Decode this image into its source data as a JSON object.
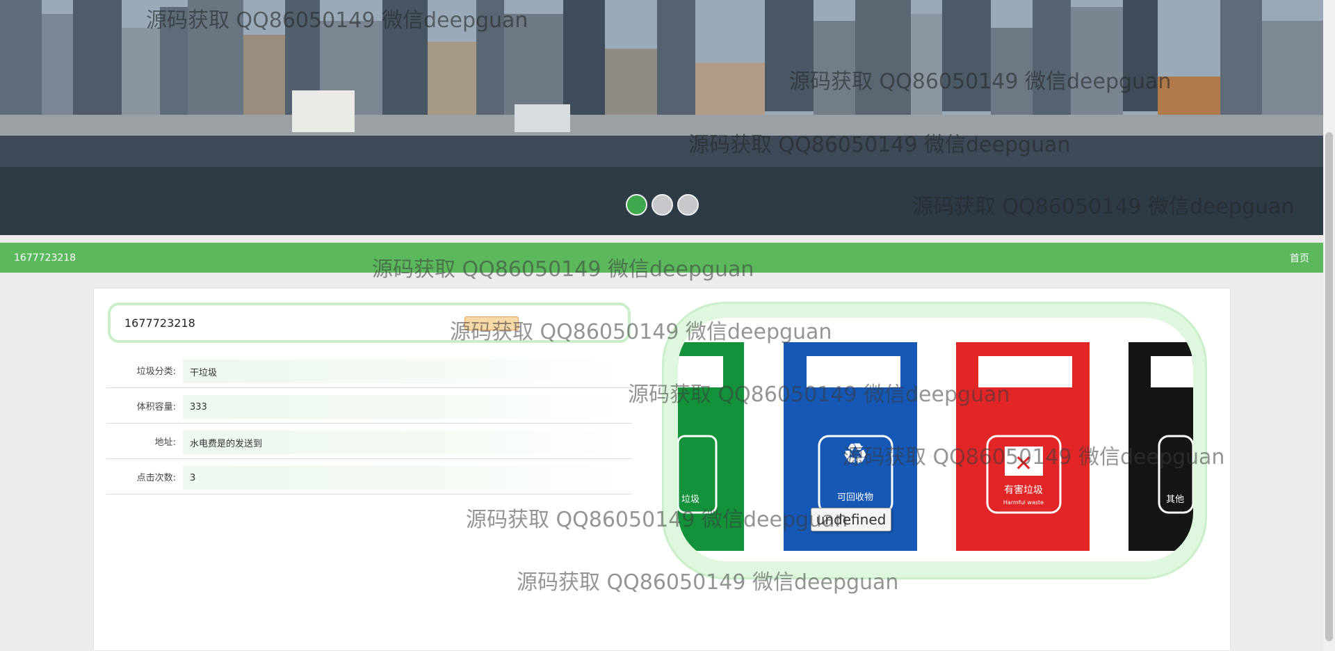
{
  "banner": {
    "slides": [
      {
        "label": "slide-1",
        "active": true
      },
      {
        "label": "slide-2",
        "active": false
      },
      {
        "label": "slide-3",
        "active": false
      }
    ]
  },
  "titlebar": {
    "title": "1677723218",
    "home_link": "首页"
  },
  "detail": {
    "name": "1677723218",
    "fields": [
      {
        "label": "垃圾分类:",
        "value": "干垃圾"
      },
      {
        "label": "体积容量:",
        "value": "333"
      },
      {
        "label": "地址:",
        "value": "水电费是的发送到"
      },
      {
        "label": "点击次数:",
        "value": "3"
      }
    ]
  },
  "image": {
    "bins": [
      {
        "color": "#13923a",
        "text": "垃圾",
        "symbol": "leaf"
      },
      {
        "color": "#1558b5",
        "text": "可回收物",
        "symbol": "recycle"
      },
      {
        "color": "#e22627",
        "text": "有害垃圾",
        "sub": "Harmful waste",
        "symbol": "x"
      },
      {
        "color": "#151515",
        "text": "其他",
        "symbol": "other"
      }
    ],
    "tooltip": "undefined"
  },
  "watermark": "源码获取 QQ86050149 微信deepguan",
  "colors": {
    "accent": "#5cb85c",
    "active_dot": "#3ea84c"
  }
}
